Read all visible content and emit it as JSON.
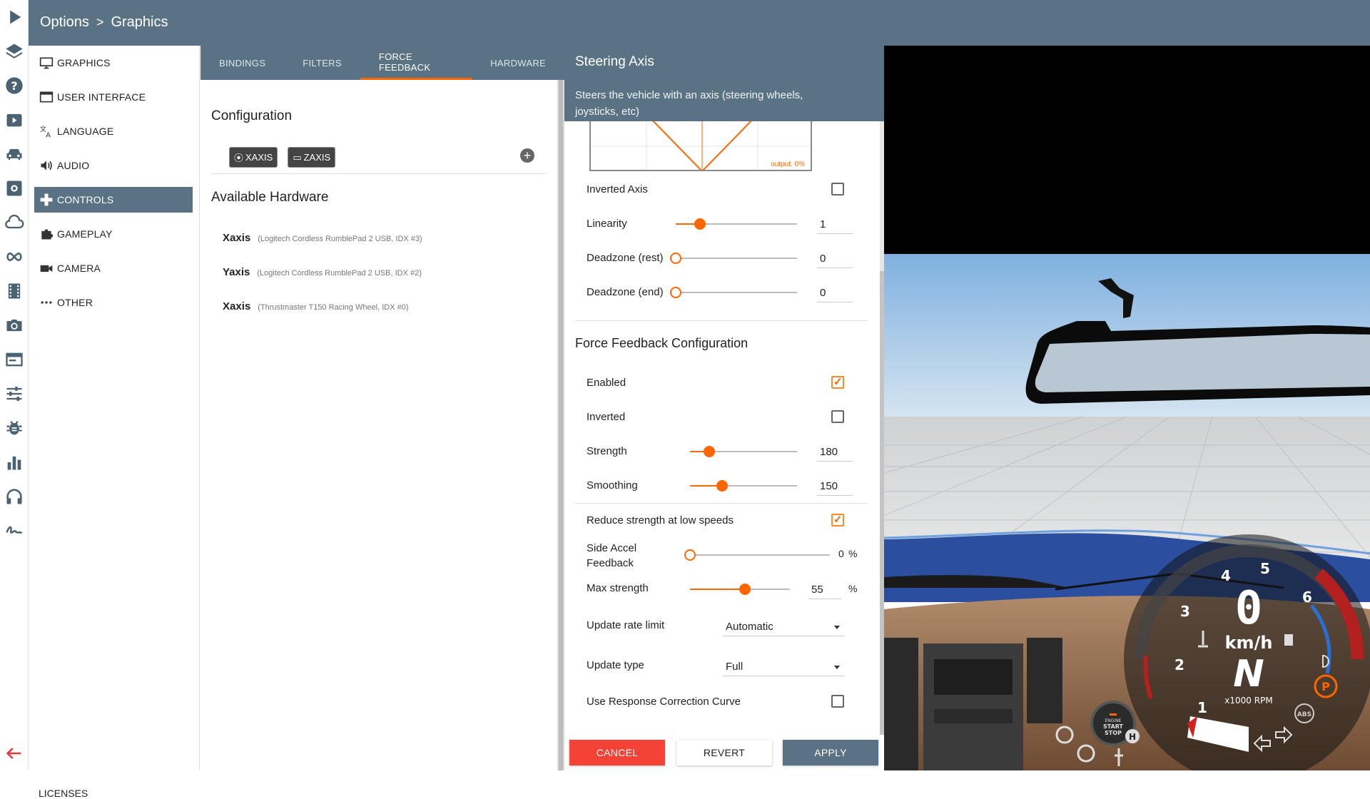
{
  "header": {
    "crumb_root": "Options",
    "crumb_separator": ">",
    "crumb_current": "Graphics"
  },
  "rail": [
    "play-icon",
    "layers-icon",
    "help-icon",
    "media-icon",
    "car-icon",
    "settings-icon",
    "cloud-icon",
    "infinity-icon",
    "film-icon",
    "camera-icon",
    "window-icon",
    "sliders-icon",
    "bug-icon",
    "chart-icon",
    "headphones-icon",
    "signature-icon",
    "back-arrow-icon"
  ],
  "menu": {
    "items": [
      {
        "label": "GRAPHICS",
        "icon": "monitor-icon"
      },
      {
        "label": "USER INTERFACE",
        "icon": "window-icon"
      },
      {
        "label": "LANGUAGE",
        "icon": "translate-icon"
      },
      {
        "label": "AUDIO",
        "icon": "speaker-icon"
      },
      {
        "label": "CONTROLS",
        "icon": "gamepad-icon",
        "active": true
      },
      {
        "label": "GAMEPLAY",
        "icon": "puzzle-icon"
      },
      {
        "label": "CAMERA",
        "icon": "video-camera-icon"
      },
      {
        "label": "OTHER",
        "icon": "more-dots-icon"
      }
    ],
    "licenses": "LICENSES"
  },
  "tabs": [
    {
      "label": "BINDINGS"
    },
    {
      "label": "FILTERS"
    },
    {
      "label": "FORCE FEEDBACK",
      "active": true
    },
    {
      "label": "HARDWARE"
    }
  ],
  "config": {
    "title": "Configuration",
    "chips": [
      {
        "label": "XAXIS"
      },
      {
        "label": "ZAXIS"
      }
    ],
    "add": "+"
  },
  "hardware": {
    "title": "Available Hardware",
    "items": [
      {
        "name": "Xaxis",
        "desc": "(Logitech Cordless RumblePad 2 USB, IDX #3)"
      },
      {
        "name": "Yaxis",
        "desc": "(Logitech Cordless RumblePad 2 USB, IDX #2)"
      },
      {
        "name": "Xaxis",
        "desc": "(Thrustmaster T150 Racing Wheel, IDX #0)"
      }
    ]
  },
  "steering": {
    "title": "Steering Axis",
    "desc": "Steers the vehicle with an axis (steering wheels, joysticks, etc)",
    "graph_output": "output: 0%",
    "inverted_label": "Inverted Axis",
    "inverted": false,
    "linearity": {
      "label": "Linearity",
      "value": "1",
      "fraction": 0.2
    },
    "deadzone_rest": {
      "label": "Deadzone (rest)",
      "value": "0",
      "fraction": 0
    },
    "deadzone_end": {
      "label": "Deadzone (end)",
      "value": "0",
      "fraction": 0
    }
  },
  "ffb": {
    "title": "Force Feedback Configuration",
    "enabled_label": "Enabled",
    "enabled": true,
    "inverted_label": "Inverted",
    "inverted": false,
    "strength": {
      "label": "Strength",
      "value": "180",
      "fraction": 0.18
    },
    "smoothing": {
      "label": "Smoothing",
      "value": "150",
      "fraction": 0.3
    },
    "reduce_label": "Reduce strength at low speeds",
    "reduce": true,
    "side_accel": {
      "label": "Side Accel Feedback",
      "value": "0",
      "unit": "%",
      "fraction": 0
    },
    "max_strength": {
      "label": "Max strength",
      "value": "55",
      "unit": "%",
      "fraction": 0.55
    },
    "update_rate": {
      "label": "Update rate limit",
      "value": "Automatic"
    },
    "update_type": {
      "label": "Update type",
      "value": "Full"
    },
    "response_curve_label": "Use Response Correction Curve",
    "response_curve": false
  },
  "buttons": {
    "cancel": "CANCEL",
    "revert": "REVERT",
    "apply": "APPLY"
  },
  "hud": {
    "speed": "0",
    "speed_unit": "km/h",
    "gear": "N",
    "rpm_unit": "x1000 RPM",
    "rpm_ticks": [
      "1",
      "2",
      "3",
      "4",
      "5",
      "6"
    ],
    "engine_button": [
      "ENGINE",
      "START",
      "STOP"
    ],
    "parking": "P",
    "abs": "ABS",
    "handbrake": "H"
  },
  "colors": {
    "accent": "#ff6600",
    "header": "#5a7384",
    "cancel": "#f44336"
  }
}
